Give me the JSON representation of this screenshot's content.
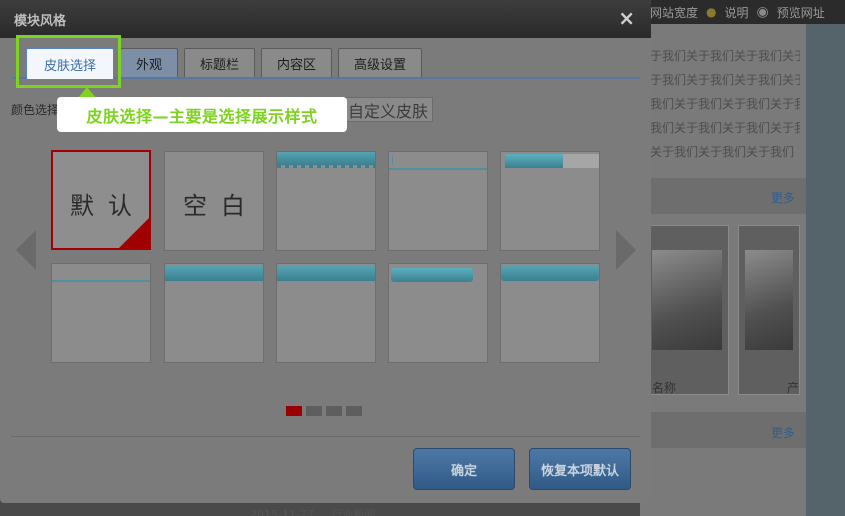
{
  "background": {
    "topbar": {
      "site_width": "网站宽度",
      "help": "说明",
      "preview": "预览网址"
    },
    "text_lines": [
      "于我们关于我们关于我们关于",
      "于我们关于我们关于我们关于",
      "我们关于我们关于我们关于我",
      "我们关于我们关于我们关于我",
      "关于我们关于我们关于我们"
    ],
    "more_1": "更多",
    "more_2": "更多",
    "caption_1": "名称",
    "caption_2": "产",
    "bottom_date": "2015-11-27",
    "bottom_text": "行业新闻"
  },
  "dialog": {
    "title": "模块风格",
    "close": "×",
    "tabs": [
      {
        "label": "皮肤选择"
      },
      {
        "label": "外观"
      },
      {
        "label": "标题栏"
      },
      {
        "label": "内容区"
      },
      {
        "label": "高级设置"
      }
    ],
    "color_label": "颜色选择",
    "custom_skin": "自定义皮肤",
    "tooltip": "皮肤选择—主要是选择展示样式",
    "skins_row1": [
      {
        "label": "默认",
        "selected": true
      },
      {
        "label": "空白"
      }
    ],
    "pager": {
      "pages": 4,
      "current": 1
    },
    "buttons": {
      "ok": "确定",
      "reset": "恢复本项默认"
    }
  },
  "colors": {
    "highlight": "#7ed321",
    "selected_border": "#a00000",
    "tab_active_text": "#3b6db1",
    "button_blue": "#3d6895",
    "skin_bar": "#4a93a3"
  }
}
